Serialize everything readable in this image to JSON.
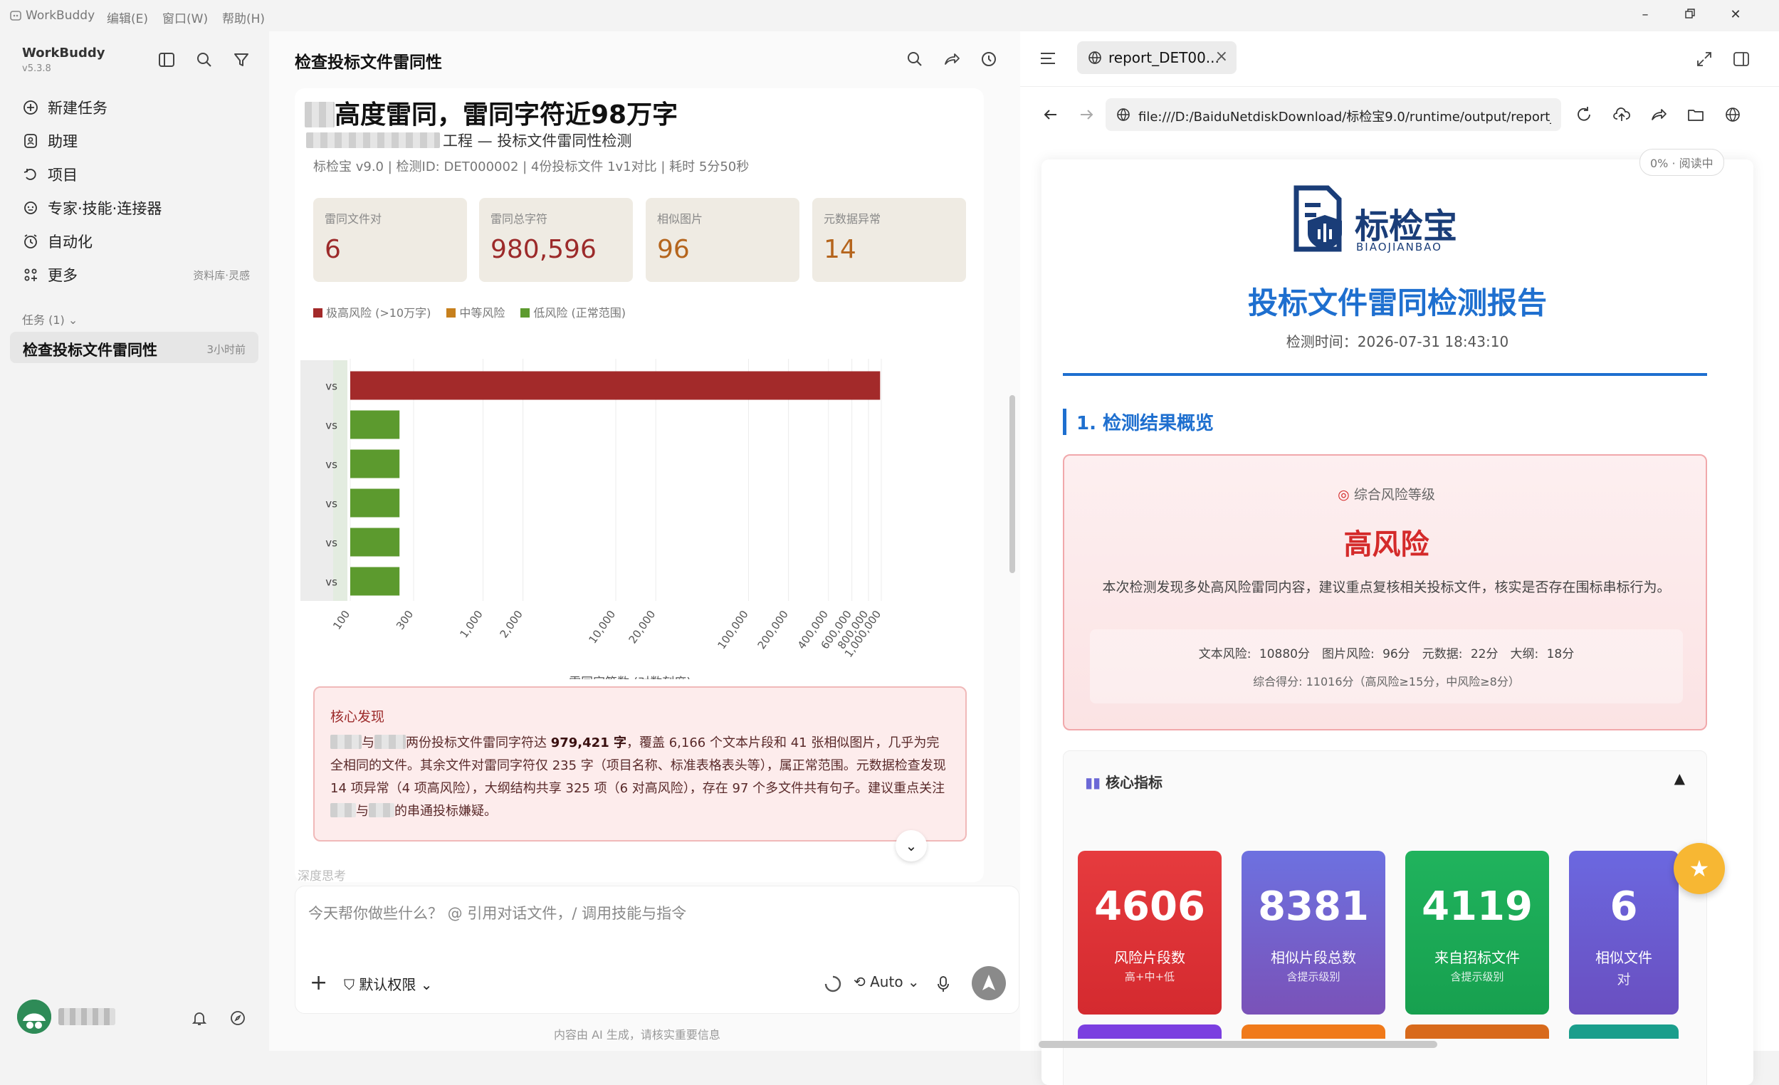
{
  "titlebar": {
    "app": "WorkBuddy",
    "menus": [
      "编辑(E)",
      "窗口(W)",
      "帮助(H)"
    ]
  },
  "sidebar": {
    "brand": "WorkBuddy",
    "version": "v5.3.8",
    "items": [
      {
        "label": "新建任务",
        "icon": "plus-circle-icon"
      },
      {
        "label": "助理",
        "icon": "assistant-icon"
      },
      {
        "label": "项目",
        "icon": "project-icon"
      },
      {
        "label": "专家·技能·连接器",
        "icon": "expert-icon"
      },
      {
        "label": "自动化",
        "icon": "automation-icon"
      },
      {
        "label": "更多",
        "icon": "more-grid-icon",
        "right": "资料库·灵感"
      }
    ],
    "tasks_header": "任务 (1)",
    "task": {
      "title": "检查投标文件雷同性",
      "time": "3小时前"
    }
  },
  "chat": {
    "title": "检查投标文件雷同性",
    "headline": "高度雷同，雷同字符近98万字",
    "subhead": "工程 — 投标文件雷同性检测",
    "meta": "标检宝 v9.0 | 检测ID: DET000002 | 4份投标文件 1v1对比 | 耗时 5分50秒",
    "stats": [
      {
        "label": "雷同文件对",
        "value": "6"
      },
      {
        "label": "雷同总字符",
        "value": "980,596"
      },
      {
        "label": "相似图片",
        "value": "96"
      },
      {
        "label": "元数据异常",
        "value": "14"
      }
    ],
    "legend": [
      {
        "label": "极高风险 (>10万字)",
        "color": "#a32a2a"
      },
      {
        "label": "中等风险",
        "color": "#c7801d"
      },
      {
        "label": "低风险 (正常范围)",
        "color": "#5c9a2e"
      }
    ],
    "finding": {
      "title": "核心发现",
      "line1a": "与",
      "line1b": "两份投标文件雷同字符达 ",
      "bold1": "979,421 字",
      "line1c": "，覆盖 6,166 个文本片段和 41 张相似图片，几乎为完全相同的文件。其余文件对雷同字符仅 235 字（项目名称、标准表格表头等），属正常范围。元数据检查发现 14 项异常（4 项高风险），大纲结构共享 325 项（6 对高风险），存在 97 个多文件共有句子。建议重点关注",
      "line1d": "与",
      "line1e": "的串通投标嫌疑。"
    },
    "faded": "深度思考",
    "input_placeholder": "今天帮你做些什么？ @ 引用对话文件，/ 调用技能与指令",
    "permission": "默认权限",
    "mode": "Auto",
    "disclaimer": "内容由 AI 生成，请核实重要信息"
  },
  "chart_data": {
    "type": "bar",
    "orientation": "horizontal",
    "categories": [
      "vs",
      "vs",
      "vs",
      "vs",
      "vs",
      "vs"
    ],
    "values": [
      979421,
      235,
      235,
      235,
      235,
      235
    ],
    "colors": [
      "#a32a2a",
      "#5c9a2e",
      "#5c9a2e",
      "#5c9a2e",
      "#5c9a2e",
      "#5c9a2e"
    ],
    "xscale": "log",
    "xlim": [
      100,
      1000000
    ],
    "xticks": [
      100,
      300,
      1000,
      2000,
      10000,
      20000,
      100000,
      200000,
      400000,
      600000,
      800000,
      1000000
    ],
    "xticklabels": [
      "100",
      "300",
      "1,000",
      "2,000",
      "10,000",
      "20,000",
      "100,000",
      "200,000",
      "400,000",
      "600,000",
      "800,000",
      "1,000,000"
    ],
    "xlabel": "雷同字符数 (对数刻度)",
    "grid": true
  },
  "browser": {
    "tab_title": "report_DET00...",
    "url": "file:///D:/BaiduNetdiskDownload/标检宝9.0/runtime/output/report_D",
    "read_badge": "0% · 阅读中",
    "report": {
      "logo_text": "标检宝",
      "logo_sub": "BIAOJIANBAO",
      "title": "投标文件雷同检测报告",
      "time": "检测时间：2026-07-31 18:43:10",
      "section1": "1. 检测结果概览",
      "risk_label": "综合风险等级",
      "risk_value": "高风险",
      "risk_desc": "本次检测发现多处高风险雷同内容，建议重点复核相关投标文件，核实是否存在围标串标行为。",
      "scores": "文本风险: 10880分　图片风险: 96分　元数据: 22分　大纲: 18分",
      "total": "综合得分: 11016分（高风险≥15分，中风险≥8分）",
      "core_title": "核心指标",
      "core_arrow": "▲",
      "kpis": [
        {
          "value": "4606",
          "label": "风险片段数",
          "sub": "高+中+低",
          "color": "#e0373a"
        },
        {
          "value": "8381",
          "label": "相似片段总数",
          "sub": "含提示级别",
          "color": "#6b68d6"
        },
        {
          "value": "4119",
          "label": "来自招标文件",
          "sub": "含提示级别",
          "color": "#1fae5a"
        },
        {
          "value": "6",
          "label": "相似文件",
          "sub": "对",
          "color": "#6a63d8"
        }
      ]
    }
  }
}
